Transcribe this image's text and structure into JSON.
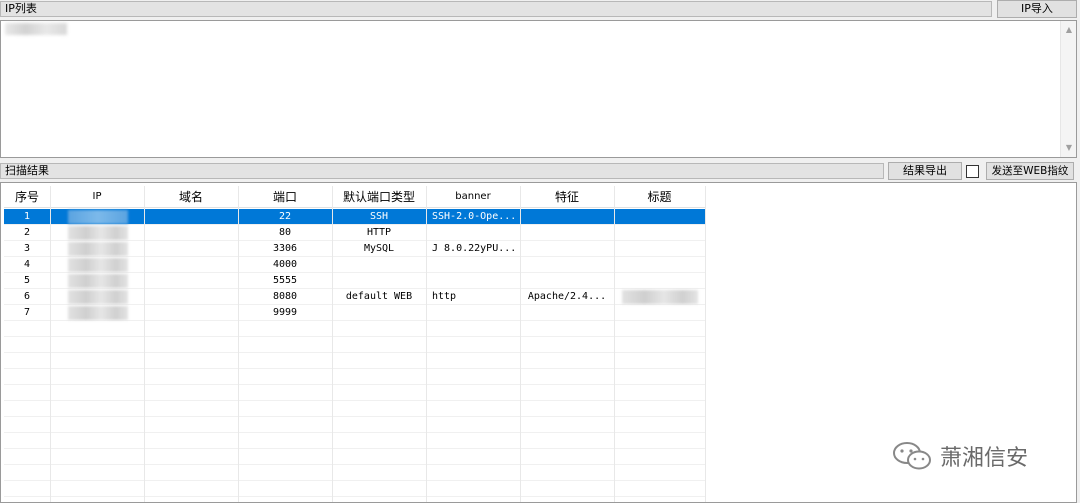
{
  "ip_panel": {
    "header": "IP列表",
    "import_button": "IP导入"
  },
  "scan_panel": {
    "header": "扫描结果",
    "export_button": "结果导出",
    "send_web_button": "发送至WEB指纹",
    "send_web_checked": false
  },
  "table": {
    "columns": [
      "序号",
      "IP",
      "域名",
      "端口",
      "默认端口类型",
      "banner",
      "特征",
      "标题"
    ],
    "rows": [
      {
        "no": "1",
        "ip": "",
        "domain": "",
        "port": "22",
        "type": "SSH",
        "banner": "SSH-2.0-Ope...",
        "feature": "",
        "title": "",
        "selected": true
      },
      {
        "no": "2",
        "ip": "",
        "domain": "",
        "port": "80",
        "type": "HTTP",
        "banner": "",
        "feature": "",
        "title": "",
        "selected": false
      },
      {
        "no": "3",
        "ip": "",
        "domain": "",
        "port": "3306",
        "type": "MySQL",
        "banner": "J 8.0.22yPU...",
        "feature": "",
        "title": "",
        "selected": false
      },
      {
        "no": "4",
        "ip": "",
        "domain": "",
        "port": "4000",
        "type": "",
        "banner": "",
        "feature": "",
        "title": "",
        "selected": false
      },
      {
        "no": "5",
        "ip": "",
        "domain": "",
        "port": "5555",
        "type": "",
        "banner": "",
        "feature": "",
        "title": "",
        "selected": false
      },
      {
        "no": "6",
        "ip": "",
        "domain": "",
        "port": "8080",
        "type": "default WEB",
        "banner": "http",
        "feature": "Apache/2.4...",
        "title": "",
        "selected": false
      },
      {
        "no": "7",
        "ip": "",
        "domain": "",
        "port": "9999",
        "type": "",
        "banner": "",
        "feature": "",
        "title": "",
        "selected": false
      }
    ]
  },
  "watermark": {
    "text": "萧湘信安",
    "icon": "wechat-icon"
  },
  "colors": {
    "selection": "#0078d7",
    "window_bg": "#f0f0f0"
  }
}
